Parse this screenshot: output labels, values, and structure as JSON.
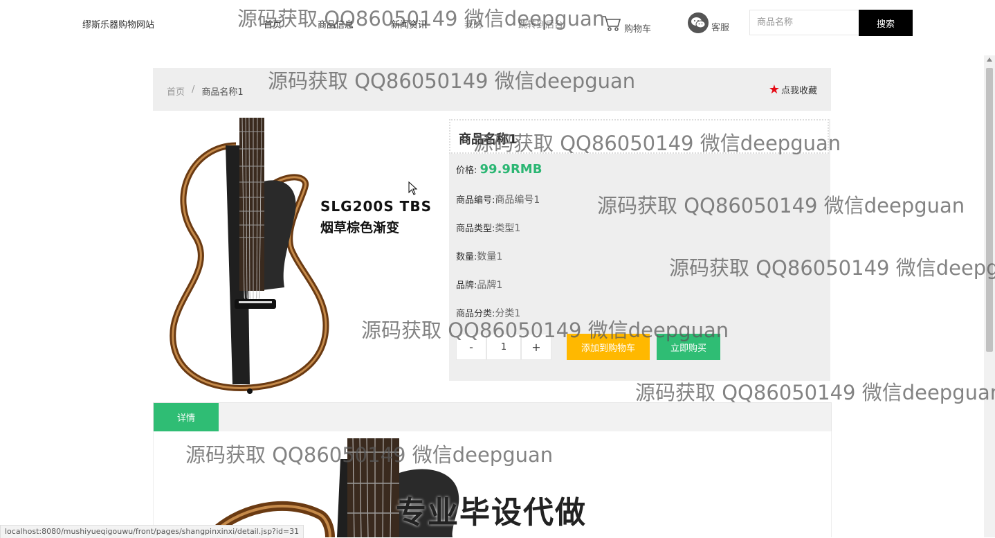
{
  "header": {
    "site_name": "缪斯乐器购物网站",
    "nav": [
      "首页",
      "商品信息",
      "新闻资讯",
      "我的",
      "跳转到后台"
    ],
    "cart_label": "购物车",
    "service_label": "客服",
    "search_placeholder": "商品名称",
    "search_button": "搜索"
  },
  "breadcrumb": {
    "home": "首页",
    "separator": "/",
    "current": "商品名称1",
    "favorite_label": "点我收藏"
  },
  "product": {
    "image_caption_line1": "SLG200S TBS",
    "image_caption_line2": "烟草棕色渐变",
    "name": "商品名称1",
    "price_label": "价格:",
    "price_value": "99.9RMB",
    "fields": [
      {
        "label": "商品编号:",
        "value": "商品编号1"
      },
      {
        "label": "商品类型:",
        "value": "类型1"
      },
      {
        "label": "数量:",
        "value": "数量1"
      },
      {
        "label": "品牌:",
        "value": "品牌1"
      },
      {
        "label": "商品分类:",
        "value": "分类1"
      }
    ],
    "quantity": "1",
    "minus": "-",
    "plus": "+",
    "add_to_cart": "添加到购物车",
    "buy_now": "立即购买"
  },
  "tabs": {
    "active": "详情"
  },
  "status_url": "localhost:8080/mushiyueqigouwu/front/pages/shangpinxinxi/detail.jsp?id=31",
  "watermark": {
    "text": "源码获取 QQ86050149 微信deepguan",
    "banner": "专业毕设代做"
  },
  "colors": {
    "accent_green": "#2fbd74",
    "cart_button": "#ffb800",
    "search_button": "#000000",
    "favorite_star": "#e50914"
  }
}
